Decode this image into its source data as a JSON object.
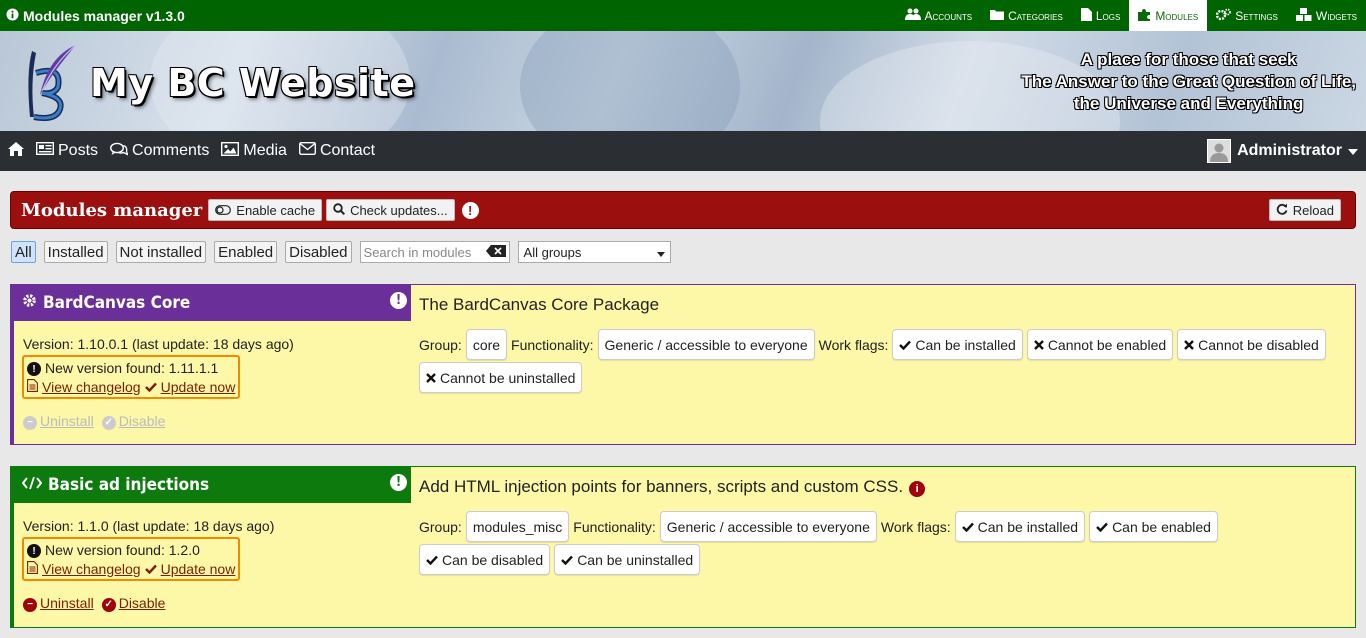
{
  "topbar": {
    "title": "Modules manager v1.3.0",
    "menu": [
      {
        "label": "Accounts",
        "icon": "users-icon"
      },
      {
        "label": "Categories",
        "icon": "folder-icon"
      },
      {
        "label": "Logs",
        "icon": "file-icon"
      },
      {
        "label": "Modules",
        "icon": "puzzle-icon",
        "active": true
      },
      {
        "label": "Settings",
        "icon": "gears-icon"
      },
      {
        "label": "Widgets",
        "icon": "cubes-icon"
      }
    ]
  },
  "header": {
    "site_title": "My BC Website",
    "tagline_1": "A place for those that seek",
    "tagline_2": "The Answer to the Great Question of Life,",
    "tagline_3": "the Universe and Everything"
  },
  "mainnav": {
    "links": [
      {
        "label": "Posts",
        "icon": "newspaper-icon"
      },
      {
        "label": "Comments",
        "icon": "comments-icon"
      },
      {
        "label": "Media",
        "icon": "image-icon"
      },
      {
        "label": "Contact",
        "icon": "envelope-icon"
      }
    ],
    "user": "Administrator"
  },
  "page": {
    "title": "Modules manager",
    "enable_cache": "Enable cache",
    "check_updates": "Check updates...",
    "reload": "Reload"
  },
  "filters": {
    "buttons": [
      "All",
      "Installed",
      "Not installed",
      "Enabled",
      "Disabled"
    ],
    "search_placeholder": "Search in modules",
    "group_select": "All groups"
  },
  "labels": {
    "group": "Group:",
    "functionality": "Functionality:",
    "work_flags": "Work flags:"
  },
  "modules": [
    {
      "name": "BardCanvas Core",
      "color": "#6b2f9a",
      "description": "The BardCanvas Core Package",
      "version": "Version: 1.10.0.1 (last update: 18 days ago)",
      "new_version": "New version found: 1.11.1.1",
      "view_changelog": "View changelog",
      "update_now": "Update now",
      "uninstall": "Uninstall",
      "disable": "Disable",
      "group": "core",
      "functionality": "Generic / accessible to everyone",
      "flags": [
        {
          "label": "Can be installed",
          "ok": true
        },
        {
          "label": "Cannot be enabled",
          "ok": false
        },
        {
          "label": "Cannot be disabled",
          "ok": false
        },
        {
          "label": "Cannot be uninstalled",
          "ok": false
        }
      ]
    },
    {
      "name": "Basic ad injections",
      "color": "#0d7a0d",
      "description": "Add HTML injection points for banners, scripts and custom CSS.",
      "version": "Version: 1.1.0 (last update: 18 days ago)",
      "new_version": "New version found: 1.2.0",
      "view_changelog": "View changelog",
      "update_now": "Update now",
      "uninstall": "Uninstall",
      "disable": "Disable",
      "group": "modules_misc",
      "functionality": "Generic / accessible to everyone",
      "flags": [
        {
          "label": "Can be installed",
          "ok": true
        },
        {
          "label": "Can be enabled",
          "ok": true
        },
        {
          "label": "Can be disabled",
          "ok": true
        },
        {
          "label": "Can be uninstalled",
          "ok": true
        }
      ]
    }
  ]
}
